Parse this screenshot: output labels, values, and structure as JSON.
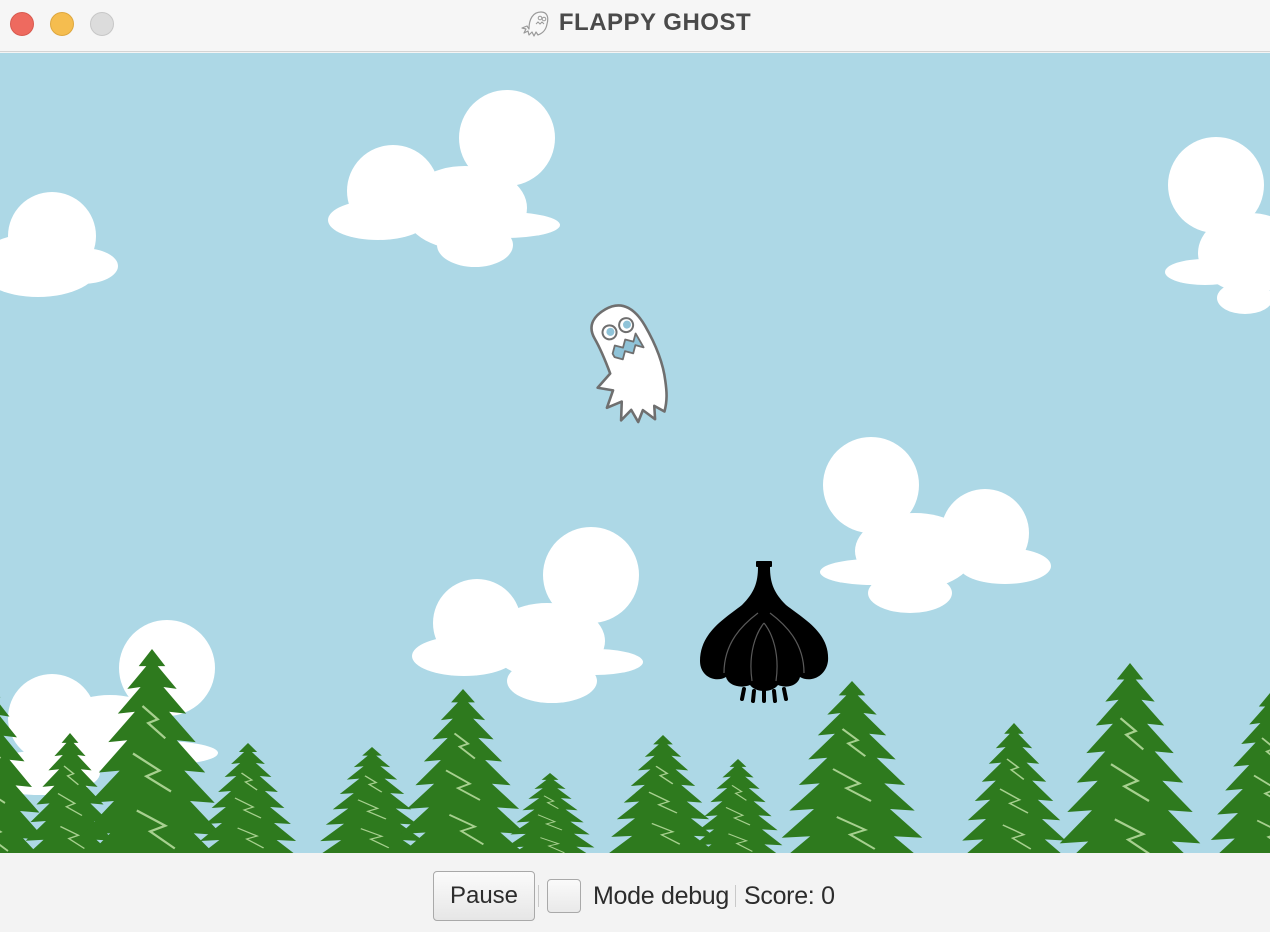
{
  "window": {
    "title": "FLAPPY GHOST",
    "title_icon": "ghost-icon"
  },
  "controls": {
    "pause_label": "Pause",
    "debug_label": "Mode debug",
    "debug_checked": false,
    "score_label": "Score:",
    "score_value": "0"
  },
  "colors": {
    "sky": "#add8e6",
    "cloud": "#ffffff",
    "tree": "#2e7a1e",
    "obstacle": "#000000",
    "ghost_body": "#ffffff",
    "ghost_accent": "#8fc3d8"
  },
  "sprites": {
    "player": "ghost-icon",
    "obstacle": "garlic-icon"
  }
}
